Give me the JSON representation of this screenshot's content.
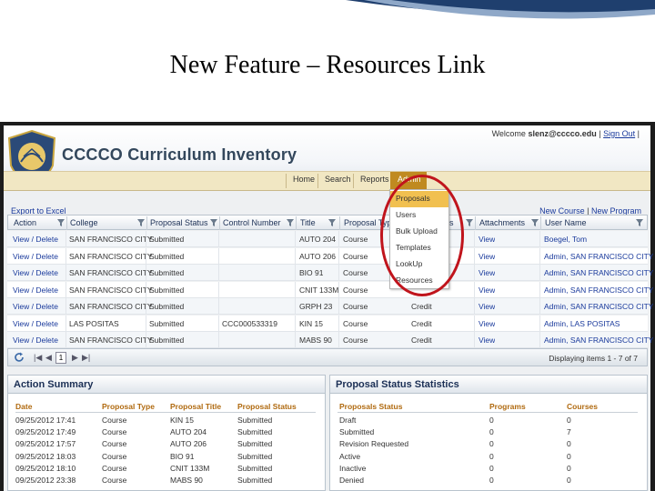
{
  "slide": {
    "title": "New Feature – Resources Link"
  },
  "app": {
    "title": "CCCCO Curriculum Inventory",
    "welcome_prefix": "Welcome",
    "user_email": "slenz@cccco.edu",
    "sign_out": "Sign Out"
  },
  "nav": {
    "home": "Home",
    "search": "Search",
    "reports": "Reports",
    "admin": "Admin"
  },
  "admin_menu": [
    "Proposals",
    "Users",
    "Bulk Upload",
    "Templates",
    "LookUp",
    "Resources"
  ],
  "toolbar": {
    "export": "Export to Excel",
    "new_course": "New Course",
    "new_program": "New Program"
  },
  "grid": {
    "headers": {
      "action": "Action",
      "college": "College",
      "proposal_status": "Proposal Status",
      "control_number": "Control Number",
      "title": "Title",
      "proposal_type": "Proposal Type",
      "credit": "s",
      "attachments": "Attachments",
      "user_name": "User Name"
    },
    "rows": [
      {
        "action": "View / Delete",
        "college": "SAN FRANCISCO CITY",
        "status": "Submitted",
        "control": "",
        "title": "AUTO 204",
        "type": "Course",
        "credit": "",
        "attachments": "View",
        "user": "Boegel, Tom"
      },
      {
        "action": "View / Delete",
        "college": "SAN FRANCISCO CITY",
        "status": "Submitted",
        "control": "",
        "title": "AUTO 206",
        "type": "Course",
        "credit": "",
        "attachments": "View",
        "user": "Admin, SAN FRANCISCO CITY"
      },
      {
        "action": "View / Delete",
        "college": "SAN FRANCISCO CITY",
        "status": "Submitted",
        "control": "",
        "title": "BIO 91",
        "type": "Course",
        "credit": "",
        "attachments": "View",
        "user": "Admin, SAN FRANCISCO CITY"
      },
      {
        "action": "View / Delete",
        "college": "SAN FRANCISCO CITY",
        "status": "Submitted",
        "control": "",
        "title": "CNIT 133M",
        "type": "Course",
        "credit": "",
        "attachments": "View",
        "user": "Admin, SAN FRANCISCO CITY"
      },
      {
        "action": "View / Delete",
        "college": "SAN FRANCISCO CITY",
        "status": "Submitted",
        "control": "",
        "title": "GRPH 23",
        "type": "Course",
        "credit": "Credit",
        "attachments": "View",
        "user": "Admin, SAN FRANCISCO CITY"
      },
      {
        "action": "View / Delete",
        "college": "LAS POSITAS",
        "status": "Submitted",
        "control": "CCC000533319",
        "title": "KIN 15",
        "type": "Course",
        "credit": "Credit",
        "attachments": "View",
        "user": "Admin, LAS POSITAS"
      },
      {
        "action": "View / Delete",
        "college": "SAN FRANCISCO CITY",
        "status": "Submitted",
        "control": "",
        "title": "MABS 90",
        "type": "Course",
        "credit": "Credit",
        "attachments": "View",
        "user": "Admin, SAN FRANCISCO CITY"
      }
    ]
  },
  "pager": {
    "page": "1",
    "displaying": "Displaying items 1 - 7 of 7"
  },
  "action_summary": {
    "title": "Action Summary",
    "headers": [
      "Date",
      "Proposal Type",
      "Proposal Title",
      "Proposal Status"
    ],
    "rows": [
      [
        "09/25/2012 17:41",
        "Course",
        "KIN 15",
        "Submitted"
      ],
      [
        "09/25/2012 17:49",
        "Course",
        "AUTO 204",
        "Submitted"
      ],
      [
        "09/25/2012 17:57",
        "Course",
        "AUTO 206",
        "Submitted"
      ],
      [
        "09/25/2012 18:03",
        "Course",
        "BIO 91",
        "Submitted"
      ],
      [
        "09/25/2012 18:10",
        "Course",
        "CNIT 133M",
        "Submitted"
      ],
      [
        "09/25/2012 23:38",
        "Course",
        "MABS 90",
        "Submitted"
      ]
    ]
  },
  "status_stats": {
    "title": "Proposal Status Statistics",
    "headers": [
      "Proposals Status",
      "Programs",
      "Courses"
    ],
    "rows": [
      [
        "Draft",
        "0",
        "0"
      ],
      [
        "Submitted",
        "0",
        "7"
      ],
      [
        "Revision Requested",
        "0",
        "0"
      ],
      [
        "Active",
        "0",
        "0"
      ],
      [
        "Inactive",
        "0",
        "0"
      ],
      [
        "Denied",
        "0",
        "0"
      ]
    ]
  }
}
